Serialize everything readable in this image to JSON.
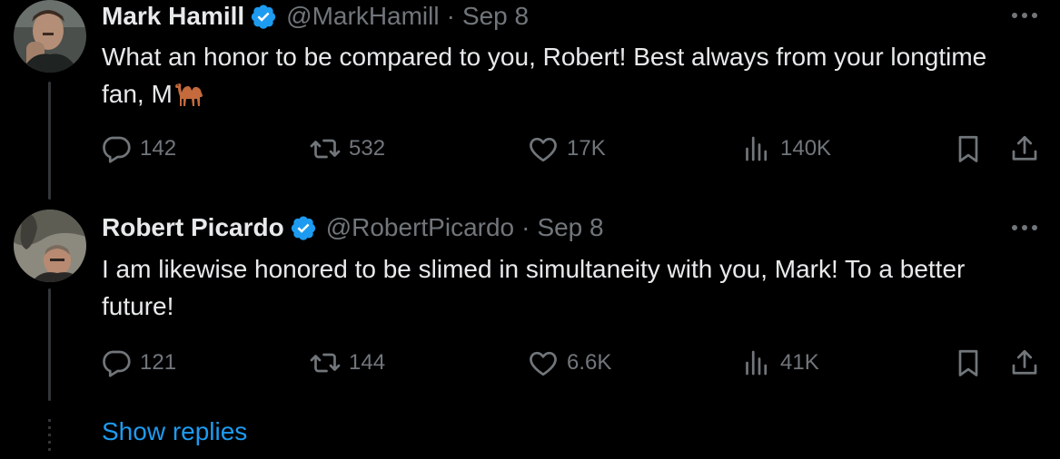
{
  "colors": {
    "background": "#000000",
    "primary_text": "#e7e9ea",
    "secondary_text": "#71767b",
    "accent": "#1d9bf0",
    "thread_line": "#333639"
  },
  "tweets": [
    {
      "display_name": "Mark Hamill",
      "verified": true,
      "handle": "@MarkHamill",
      "separator": "·",
      "date": "Sep 8",
      "text": "What an honor to be compared to you, Robert! Best always from your longtime fan, M",
      "emoji": "camel-emoji",
      "replies": "142",
      "retweets": "532",
      "likes": "17K",
      "views": "140K"
    },
    {
      "display_name": "Robert Picardo",
      "verified": true,
      "handle": "@RobertPicardo",
      "separator": "·",
      "date": "Sep 8",
      "text": "I am likewise honored to be slimed in simultaneity with you, Mark! To a better future!",
      "replies": "121",
      "retweets": "144",
      "likes": "6.6K",
      "views": "41K"
    }
  ],
  "show_replies_label": "Show replies",
  "icons": [
    "verified-badge-icon",
    "more-icon",
    "reply-icon",
    "retweet-icon",
    "like-icon",
    "views-icon",
    "bookmark-icon",
    "share-icon"
  ]
}
